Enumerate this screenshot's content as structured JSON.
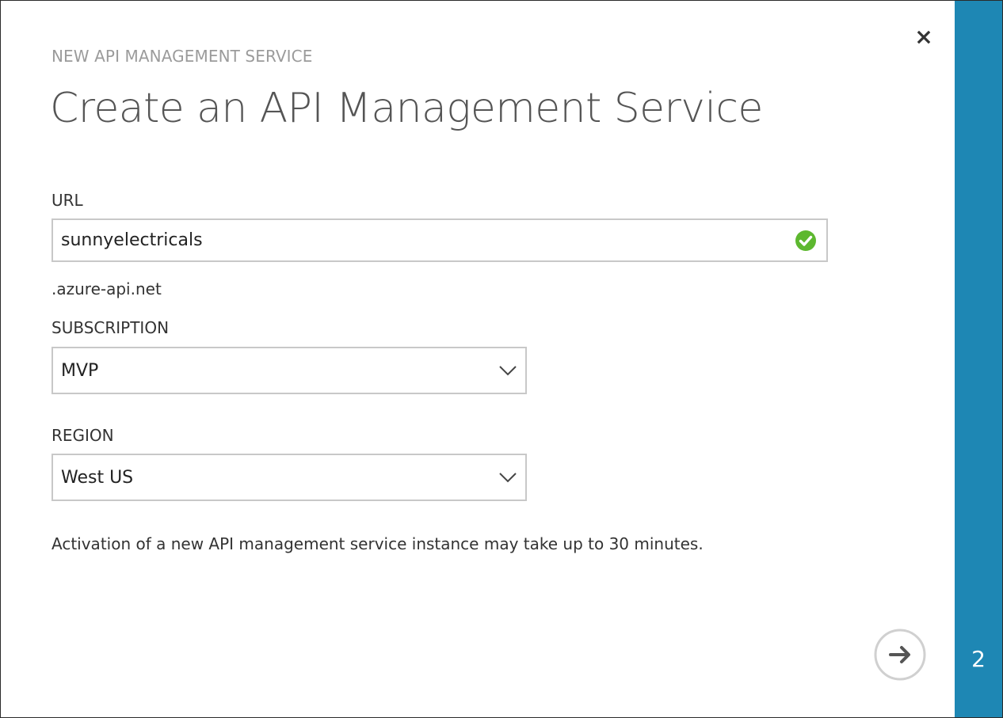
{
  "dialog": {
    "overline": "NEW API MANAGEMENT SERVICE",
    "title": "Create an API Management Service",
    "close_icon": "close-icon"
  },
  "url": {
    "label": "URL",
    "value": "sunnyelectricals",
    "valid_icon": "check-circle-icon",
    "valid_color": "#5db82f",
    "suffix": ".azure-api.net"
  },
  "subscription": {
    "label": "SUBSCRIPTION",
    "selected": "MVP"
  },
  "region": {
    "label": "REGION",
    "selected": "West US"
  },
  "note": "Activation of a new API management service instance may take up to 30 minutes.",
  "footer": {
    "next_icon": "arrow-right-icon"
  },
  "wizard": {
    "step": "2",
    "accent_color": "#1e87b4"
  }
}
